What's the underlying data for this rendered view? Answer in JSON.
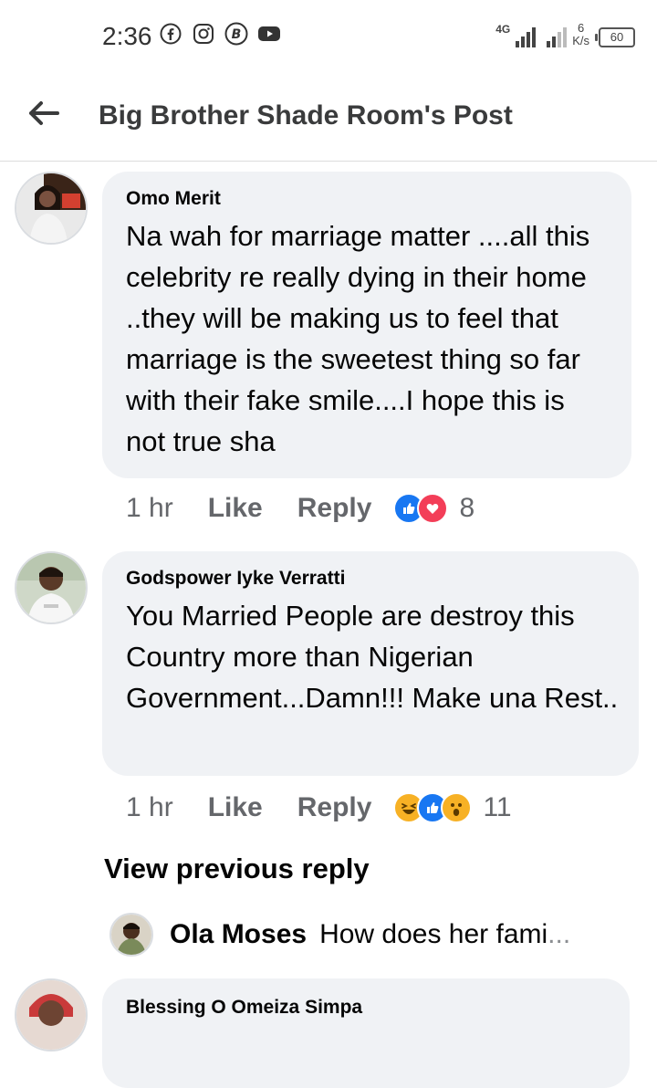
{
  "status_bar": {
    "time": "2:36",
    "network": "4G",
    "speed_value": "6",
    "speed_unit": "K/s",
    "battery": "60",
    "app_icons": [
      "facebook-icon",
      "instagram-icon",
      "b-app-icon",
      "youtube-icon"
    ]
  },
  "header": {
    "title": "Big Brother Shade Room's Post"
  },
  "comments": [
    {
      "author": "Omo Merit",
      "text": "Na wah for marriage matter ....all this celebrity re really dying in their home  ..they will be making us to feel that marriage is the sweetest thing so far with their fake smile....I hope this is not true sha",
      "time": "1 hr",
      "like_label": "Like",
      "reply_label": "Reply",
      "reactions": [
        "like",
        "love"
      ],
      "reaction_count": "8"
    },
    {
      "author": "Godspower Iyke Verratti",
      "text": "You Married People are destroy this Country more than Nigerian Government...Damn!!! Make una Rest..",
      "time": "1 hr",
      "like_label": "Like",
      "reply_label": "Reply",
      "reactions": [
        "haha",
        "like",
        "wow"
      ],
      "reaction_count": "11"
    }
  ],
  "view_previous_reply": "View previous reply",
  "reply_preview": {
    "author": "Ola Moses",
    "text": "How does her fami",
    "ellipsis": "..."
  },
  "next_comment": {
    "author": "Blessing O Omeiza Simpa"
  },
  "colors": {
    "bubble": "#f0f2f5",
    "like_blue": "#1877f2",
    "love_red": "#f33e58",
    "haha_yellow": "#f7b125",
    "meta_gray": "#65676b"
  }
}
